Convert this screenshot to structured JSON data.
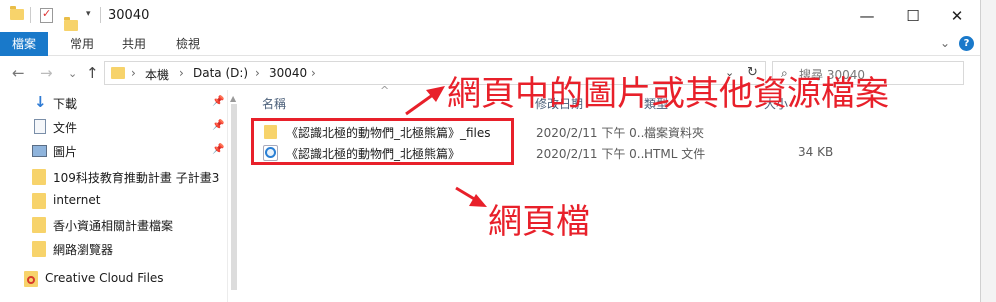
{
  "titlebar": {
    "title": "30040",
    "minimize": "—",
    "maximize": "☐",
    "close": "✕"
  },
  "ribbon": {
    "file_tab": "檔案",
    "tabs": [
      "常用",
      "共用",
      "檢視"
    ],
    "expand": "⌄",
    "help": "?"
  },
  "address": {
    "back": "←",
    "forward": "→",
    "recent": "⌄",
    "up": "↑",
    "crumbs": [
      "本機",
      "Data (D:)",
      "30040"
    ],
    "separator": "›",
    "dropdown": "⌄",
    "refresh": "↻"
  },
  "search": {
    "placeholder": "搜尋 30040"
  },
  "navpane": {
    "items": [
      {
        "label": "下載",
        "icon": "download-icon",
        "pinned": true
      },
      {
        "label": "文件",
        "icon": "document-icon",
        "pinned": true
      },
      {
        "label": "圖片",
        "icon": "picture-icon",
        "pinned": true
      },
      {
        "label": "109科技教育推動計畫 子計畫3",
        "icon": "folder-icon",
        "pinned": false
      },
      {
        "label": "internet",
        "icon": "folder-icon",
        "pinned": false
      },
      {
        "label": "香小資通相關計畫檔案",
        "icon": "folder-icon",
        "pinned": false
      },
      {
        "label": "網路瀏覽器",
        "icon": "folder-icon",
        "pinned": false
      },
      {
        "label": "Creative Cloud Files",
        "icon": "creative-cloud-icon",
        "pinned": false
      }
    ],
    "pin_glyph": "📌"
  },
  "columns": {
    "name": "名稱",
    "date": "修改日期",
    "type": "類型",
    "size": "大小"
  },
  "files": [
    {
      "name": "《認識北極的動物們_北極熊篇》_files",
      "date": "2020/2/11 下午 0...",
      "type": "檔案資料夾",
      "size": "",
      "icon": "folder-icon"
    },
    {
      "name": "《認識北極的動物們_北極熊篇》",
      "date": "2020/2/11 下午 0...",
      "type": "HTML 文件",
      "size": "34 KB",
      "icon": "html-file-icon"
    }
  ],
  "annotations": {
    "top": "網頁中的圖片或其他資源檔案",
    "bottom": "網頁檔"
  },
  "colors": {
    "accent": "#1979ca",
    "annotation_red": "#e8202a",
    "folder_yellow": "#f7d36b"
  }
}
